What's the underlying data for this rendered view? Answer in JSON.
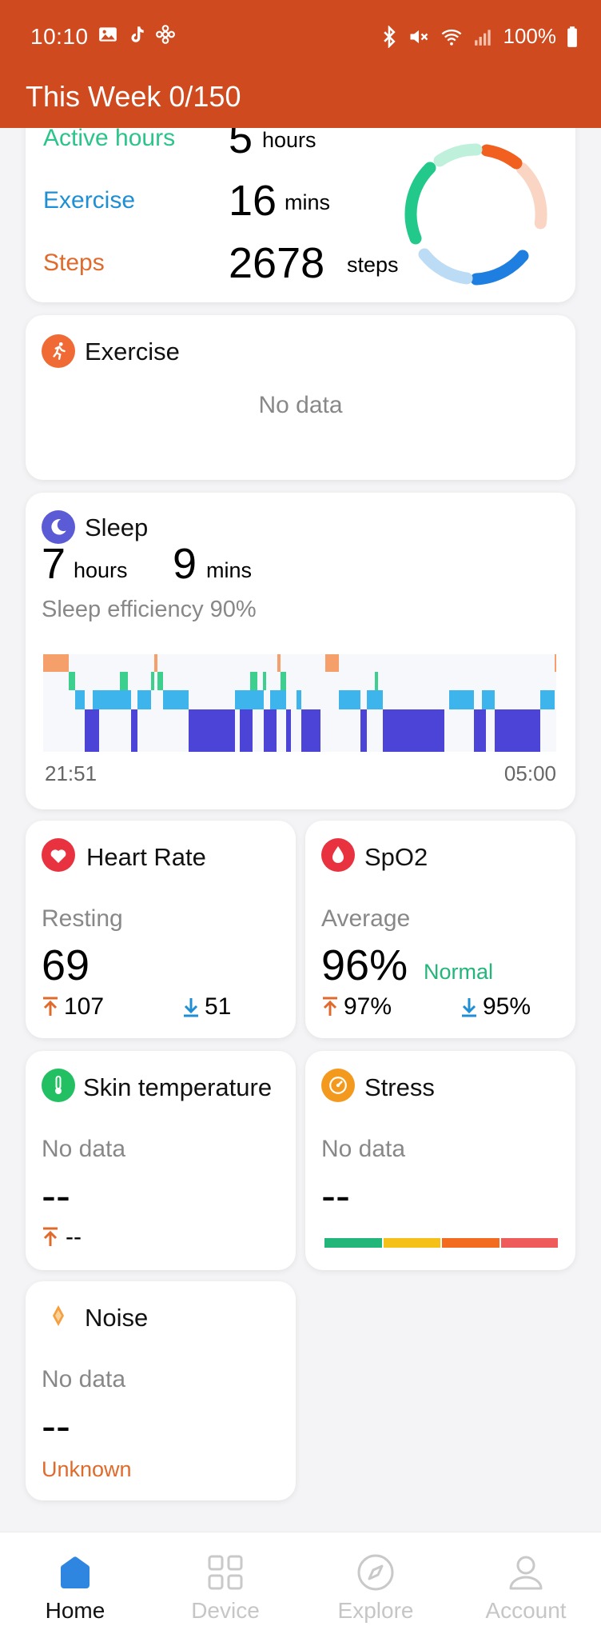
{
  "status": {
    "time": "10:10",
    "battery": "100%"
  },
  "header": {
    "title": "This Week 0/150"
  },
  "activity": {
    "rows": [
      {
        "label": "Active hours",
        "value": "5",
        "unit": "hours",
        "color": "#2cc48a"
      },
      {
        "label": "Exercise",
        "value": "16",
        "unit": "mins",
        "color": "#1f8fd4"
      },
      {
        "label": "Steps",
        "value": "2678",
        "unit": "steps",
        "color": "#e06a2c"
      }
    ],
    "ring_colors": {
      "orange": "#f2601f",
      "orange_light": "#fbd5c4",
      "blue": "#1f7fe0",
      "blue_light": "#bcdcf6",
      "green": "#22c98a",
      "green_light": "#bff0dc"
    }
  },
  "exercise": {
    "title": "Exercise",
    "no_data": "No data"
  },
  "sleep": {
    "title": "Sleep",
    "hours": "7",
    "hours_unit": "hours",
    "mins": "9",
    "mins_unit": "mins",
    "efficiency": "Sleep efficiency 90%",
    "start_time": "21:51",
    "end_time": "05:00",
    "colors": {
      "awake": "#f5a06a",
      "rem": "#3ccf8e",
      "light": "#3eb4ec",
      "deep": "#4b44d6"
    }
  },
  "heart_rate": {
    "title": "Heart Rate",
    "sub": "Resting",
    "value": "69",
    "max": "107",
    "min": "51"
  },
  "spo2": {
    "title": "SpO2",
    "sub": "Average",
    "value": "96%",
    "status": "Normal",
    "max": "97%",
    "min": "95%"
  },
  "skin_temp": {
    "title": "Skin temperature",
    "no_data": "No data",
    "value": "--",
    "max": "--"
  },
  "stress": {
    "title": "Stress",
    "no_data": "No data",
    "value": "--",
    "bar_colors": [
      "#22b67a",
      "#f5c018",
      "#f26b1f",
      "#ef5b5b"
    ]
  },
  "noise": {
    "title": "Noise",
    "no_data": "No data",
    "value": "--",
    "status": "Unknown"
  },
  "nav": {
    "home": "Home",
    "device": "Device",
    "explore": "Explore",
    "account": "Account"
  }
}
